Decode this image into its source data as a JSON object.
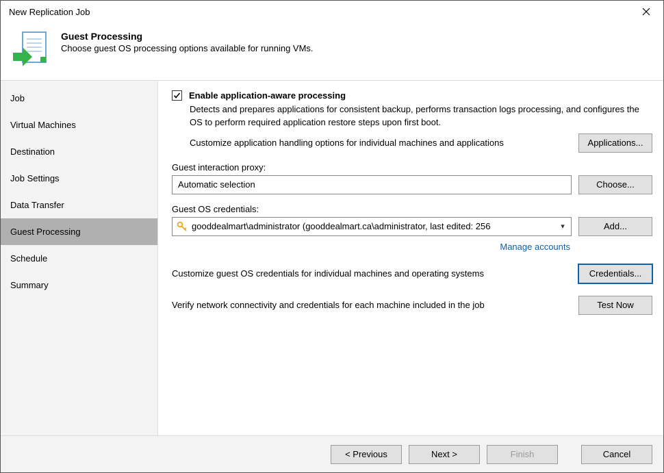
{
  "window": {
    "title": "New Replication Job"
  },
  "header": {
    "title": "Guest Processing",
    "subtitle": "Choose guest OS processing options available for running VMs."
  },
  "sidebar": {
    "items": [
      {
        "label": "Job"
      },
      {
        "label": "Virtual Machines"
      },
      {
        "label": "Destination"
      },
      {
        "label": "Job Settings"
      },
      {
        "label": "Data Transfer"
      },
      {
        "label": "Guest Processing"
      },
      {
        "label": "Schedule"
      },
      {
        "label": "Summary"
      }
    ]
  },
  "main": {
    "enable_aap": {
      "label": "Enable application-aware processing",
      "checked": true,
      "description": "Detects and prepares applications for consistent backup, performs transaction logs processing, and configures the OS to perform required application restore steps upon first boot.",
      "customize_text": "Customize application handling options for individual machines and applications",
      "applications_btn": "Applications..."
    },
    "proxy": {
      "label": "Guest interaction proxy:",
      "value": "Automatic selection",
      "choose_btn": "Choose..."
    },
    "creds": {
      "label": "Guest OS credentials:",
      "value": "gooddealmart\\administrator (gooddealmart.ca\\administrator, last edited: 256",
      "add_btn": "Add...",
      "manage_link": "Manage accounts",
      "customize_text": "Customize guest OS credentials for individual machines and operating systems",
      "credentials_btn": "Credentials..."
    },
    "verify": {
      "text": "Verify network connectivity and credentials for each machine included in the job",
      "test_btn": "Test Now"
    }
  },
  "footer": {
    "previous": "< Previous",
    "next": "Next >",
    "finish": "Finish",
    "cancel": "Cancel"
  }
}
